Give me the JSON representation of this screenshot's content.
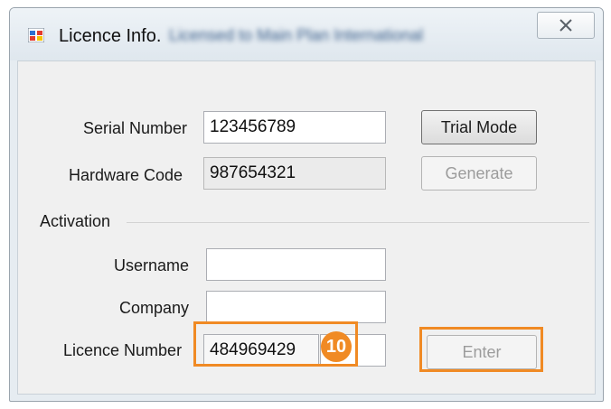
{
  "window": {
    "title": "Licence Info.",
    "title_suffix": "Licensed to Main Plan  International"
  },
  "form": {
    "serial_label": "Serial Number",
    "serial_value": "123456789",
    "hardware_label": "Hardware Code",
    "hardware_value": "987654321",
    "activation_label": "Activation",
    "username_label": "Username",
    "username_value": "",
    "company_label": "Company",
    "company_value": "",
    "licence_label": "Licence Number",
    "licence_value": "484969429"
  },
  "buttons": {
    "trial_mode": "Trial Mode",
    "generate": "Generate",
    "enter": "Enter"
  },
  "annotation": {
    "step_number": "10",
    "highlight_color": "#f08a24"
  },
  "icons": {
    "app": "licence-app-icon",
    "close": "close-icon"
  }
}
